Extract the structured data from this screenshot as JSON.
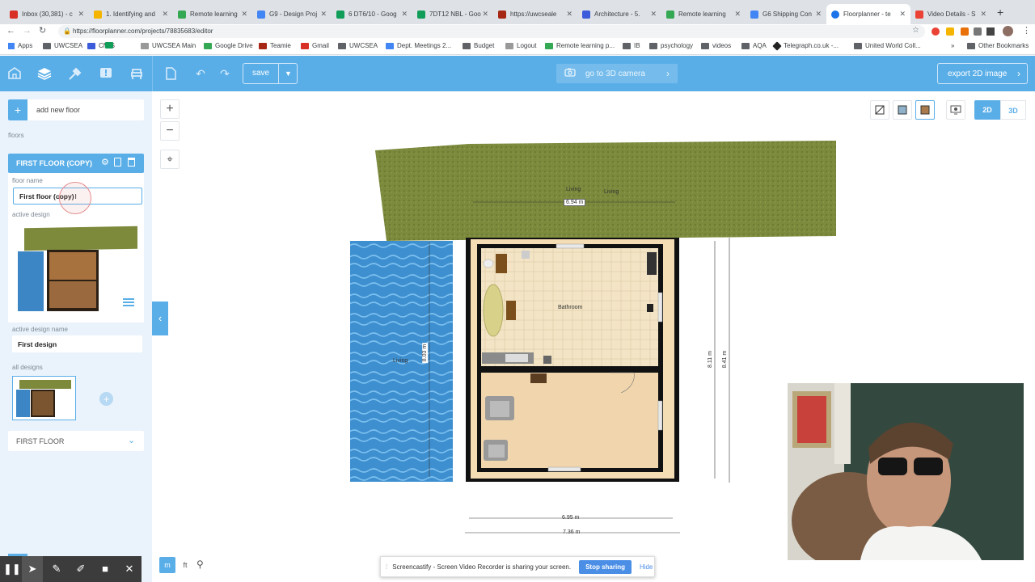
{
  "browser": {
    "tabs": [
      {
        "title": "Inbox (30,381) - c",
        "color": "#d93025"
      },
      {
        "title": "1. Identifying and",
        "color": "#f4b400"
      },
      {
        "title": "Remote learning",
        "color": "#34a853"
      },
      {
        "title": "G9 - Design Proj",
        "color": "#4285f4"
      },
      {
        "title": "6 DT6/10 - Goog",
        "color": "#0f9d58"
      },
      {
        "title": "7DT12 NBL - Goo",
        "color": "#0f9d58"
      },
      {
        "title": "https://uwcseale",
        "color": "#a52714"
      },
      {
        "title": "Architecture - 5.",
        "color": "#3b5bdb"
      },
      {
        "title": "Remote learning",
        "color": "#34a853"
      },
      {
        "title": "G6 Shipping Con",
        "color": "#4285f4"
      },
      {
        "title": "Floorplanner - te",
        "color": "#1a73e8"
      },
      {
        "title": "Video Details - S",
        "color": "#ea4335"
      }
    ],
    "url": "https://floorplanner.com/projects/78835683/editor",
    "bookmarks": [
      "Apps",
      "UWCSEA",
      "CMIS",
      "UWCSEA Main",
      "Google Drive",
      "Teamie",
      "Gmail",
      "UWCSEA",
      "Dept. Meetings 2...",
      "Budget",
      "Logout",
      "Remote learning p...",
      "IB",
      "psychology",
      "videos",
      "AQA",
      "Telegraph.co.uk -...",
      "United World Coll..."
    ],
    "other_bookmarks": "Other Bookmarks",
    "overflow": "»"
  },
  "toolbar": {
    "save_label": "save",
    "camera_label": "go to 3D camera",
    "export_label": "export 2D image",
    "view_2d": "2D",
    "view_3d": "3D",
    "accent": "#5aaee8"
  },
  "sidebar": {
    "add_floor_label": "add new floor",
    "floors_label": "floors",
    "current_floor": "FIRST FLOOR (COPY)",
    "floor_name_label": "floor name",
    "floor_name_value": "First floor (copy)",
    "active_design_label": "active design",
    "active_design_name_label": "active design name",
    "active_design_name_value": "First design",
    "all_designs_label": "all designs",
    "other_floor": "FIRST FLOOR"
  },
  "plan": {
    "room_labels": [
      "Living",
      "Living",
      "Bathroom",
      "Living"
    ],
    "dimensions": [
      "6.94 m",
      "8.03 m",
      "8.11 m",
      "8.41 m",
      "6.95 m",
      "7.36 m"
    ]
  },
  "units": {
    "metric": "m",
    "imperial": "ft"
  },
  "screencastify": {
    "message": "Screencastify - Screen Video Recorder is sharing your screen.",
    "stop_label": "Stop sharing",
    "hide_label": "Hide"
  }
}
